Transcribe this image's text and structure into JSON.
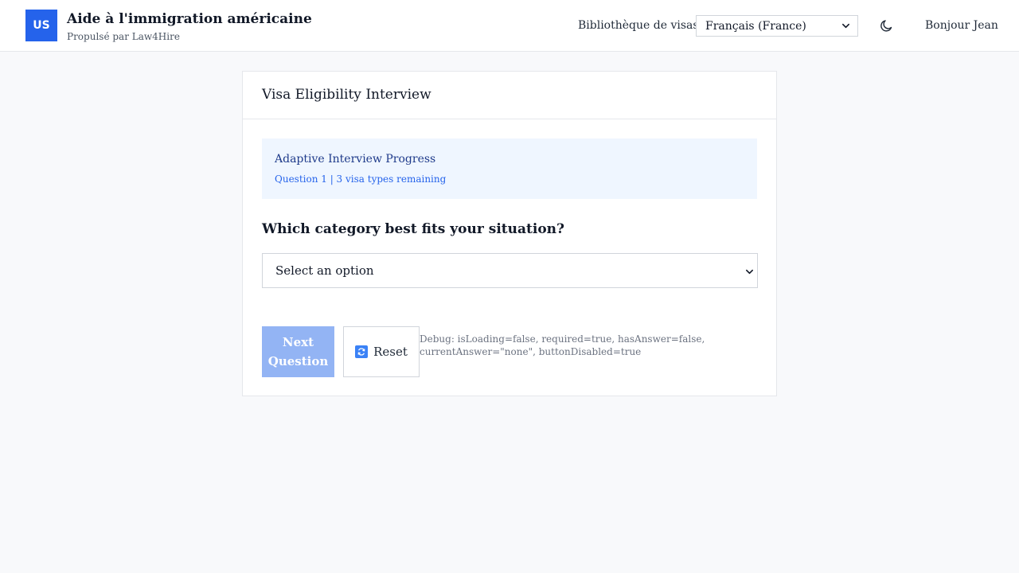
{
  "header": {
    "logo_text": "US",
    "title": "Aide à l'immigration américaine",
    "subtitle": "Propulsé par Law4Hire",
    "nav_link": "Bibliothèque de visas",
    "language": {
      "selected": "Français (France)"
    },
    "theme_toggle_icon": "moon-icon",
    "greeting": "Bonjour Jean"
  },
  "card": {
    "title": "Visa Eligibility Interview",
    "progress": {
      "title": "Adaptive Interview Progress",
      "status": "Question 1 | 3 visa types remaining"
    },
    "question": "Which category best fits your situation?",
    "answer_select": {
      "selected": "Select an option"
    },
    "next_button": "Next Question",
    "reset_button": "Reset",
    "reset_icon": "refresh-icon",
    "debug_text": "Debug: isLoading=false, required=true, hasAnswer=false, currentAnswer=\"none\", buttonDisabled=true"
  },
  "colors": {
    "brand": "#2563eb",
    "progress_bg": "#eff6ff",
    "disabled_button": "#93b4f4"
  }
}
